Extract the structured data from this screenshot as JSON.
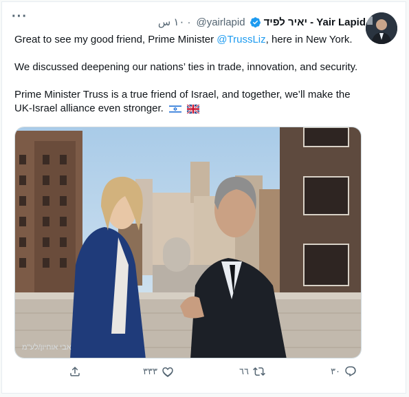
{
  "tweet": {
    "author_name": "יאיר לפיד - Yair Lapid",
    "handle": "@yairlapid",
    "time": "١٠ س",
    "more_label": "···",
    "paragraph1_pre": "Great to see my good friend, Prime Minister ",
    "mention": "@TrussLiz",
    "paragraph1_post": ", here in New York.",
    "paragraph2": "We discussed deepening our nations’ ties in trade, innovation, and security.",
    "paragraph3": "Prime Minister Truss is a true friend of Israel, and together, we’ll make the UK-Israel alliance even stronger.",
    "photo_credit": "אבי אוחיון/לע\"מ"
  },
  "actions": {
    "replies": "٣٠",
    "retweets": "٦٦",
    "likes": "٣٣٣"
  },
  "icons": [
    "more-icon",
    "verified-icon",
    "israel-flag-icon",
    "uk-flag-icon",
    "reply-icon",
    "retweet-icon",
    "like-icon",
    "share-icon"
  ],
  "colors": {
    "accent": "#1d9bf0",
    "text": "#0f1419",
    "muted": "#536471"
  }
}
